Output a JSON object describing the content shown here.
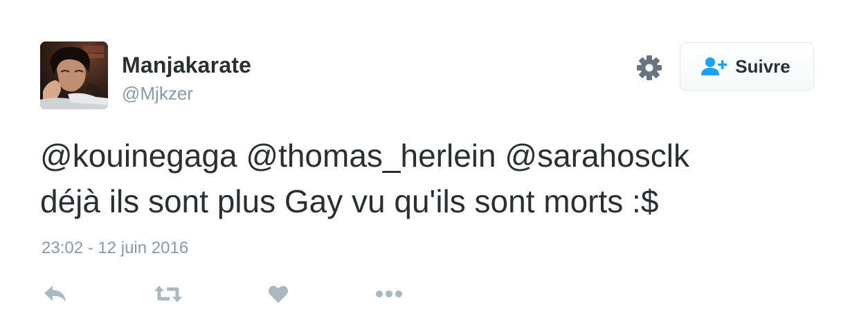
{
  "tweet": {
    "display_name": "Manjakarate",
    "screen_name": "@Mjkzer",
    "text_line1": [
      {
        "type": "mention",
        "text": "@kouinegaga"
      },
      {
        "type": "text",
        "text": " "
      },
      {
        "type": "mention",
        "text": "@thomas_herlein"
      },
      {
        "type": "text",
        "text": " "
      },
      {
        "type": "mention",
        "text": "@sarahosclk"
      }
    ],
    "text_line2": "déjà ils sont plus Gay vu qu'ils sont morts :$",
    "timestamp": "23:02 - 12 juin 2016"
  },
  "follow_button": {
    "label": "Suivre",
    "icon": "add-user-icon",
    "icon_color": "#1da1f2"
  },
  "icons": {
    "settings": "gear-icon",
    "reply": "reply-icon",
    "retweet": "retweet-icon",
    "like": "heart-icon",
    "more": "more-icon"
  },
  "colors": {
    "text": "#292f33",
    "secondary": "#8899a6",
    "action_icon": "#aab8c2",
    "accent": "#1da1f2",
    "border": "#e1e8ed"
  }
}
